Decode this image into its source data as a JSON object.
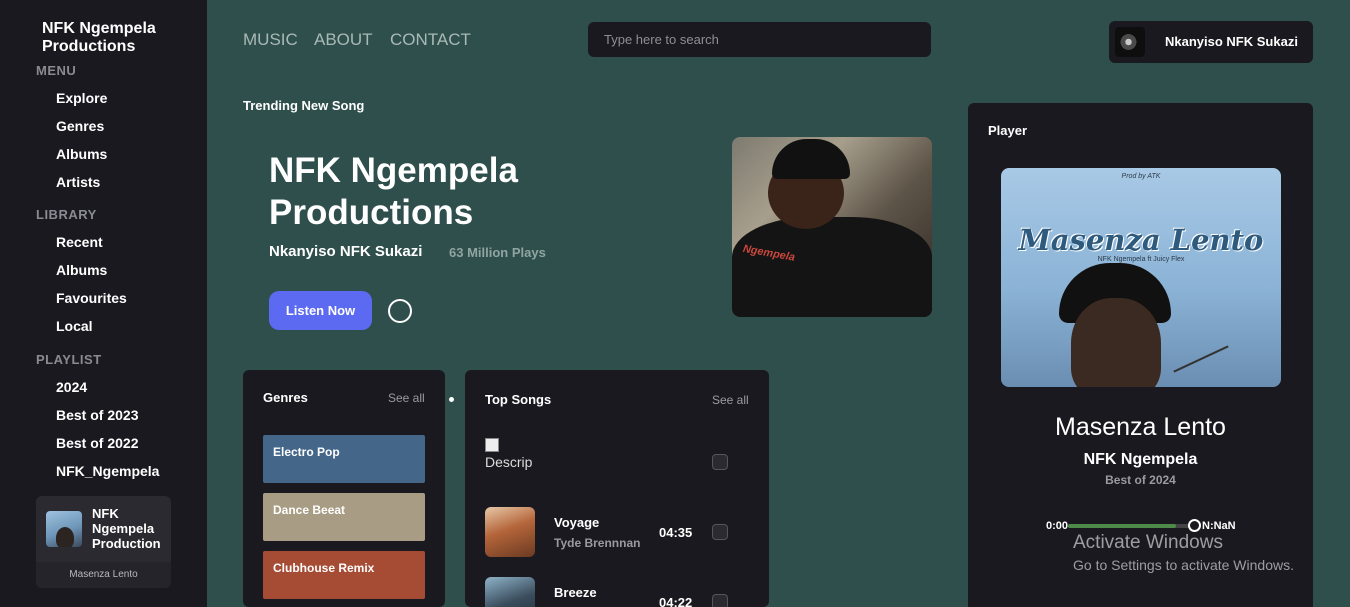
{
  "sidebar": {
    "brand": "NFK Ngempela Productions",
    "menu_title": "MENU",
    "menu_items": [
      "Explore",
      "Genres",
      "Albums",
      "Artists"
    ],
    "library_title": "LIBRARY",
    "library_items": [
      "Recent",
      "Albums",
      "Favourites",
      "Local"
    ],
    "playlist_title": "PLAYLIST",
    "playlist_items": [
      "2024",
      "Best of 2023",
      "Best of 2022",
      "NFK_Ngempela"
    ],
    "now_card": {
      "title": "NFK Ngempela Production",
      "subtitle": "Masenza Lento"
    }
  },
  "topnav": {
    "links": [
      "MUSIC",
      "ABOUT",
      "CONTACT"
    ],
    "search_placeholder": "Type here to search",
    "profile_name": "Nkanyiso NFK Sukazi"
  },
  "hero": {
    "label": "Trending New Song",
    "title": "NFK Ngempela Productions",
    "artist": "Nkanyiso NFK Sukazi",
    "plays": "63 Million Plays",
    "listen_label": "Listen Now",
    "image_logo": "Ngempela"
  },
  "genres": {
    "title": "Genres",
    "see_all": "See all",
    "items": [
      {
        "label": "Electro Pop",
        "color": "#436689"
      },
      {
        "label": "Dance Beeat",
        "color": "#a89c84"
      },
      {
        "label": "Clubhouse Remix",
        "color": "#a64c34"
      }
    ]
  },
  "top_songs": {
    "title": "Top Songs",
    "see_all": "See all",
    "broken_alt": "Descrip",
    "items": [
      {
        "title": "Voyage",
        "artist": "Tyde Brennnan",
        "duration": "04:35"
      },
      {
        "title": "Breeze",
        "artist": "",
        "duration": "04:22"
      }
    ]
  },
  "player": {
    "label": "Player",
    "cover_title": "Masenza Lento",
    "cover_subtitle": "NFK Ngempela ft Juicy Flex",
    "cover_credit": "Prod by ATK",
    "track_title": "Masenza Lento",
    "track_artist": "NFK Ngempela",
    "track_album": "Best of 2024",
    "time_current": "0:00",
    "time_total": "N:NaN",
    "progress": 0.86
  },
  "watermark": {
    "line1": "Activate Windows",
    "line2": "Go to Settings to activate Windows."
  },
  "colors": {
    "background": "#2f4f4c",
    "panel": "#1a191f",
    "accent": "#5b6af0",
    "progress": "#4e8a4a"
  }
}
